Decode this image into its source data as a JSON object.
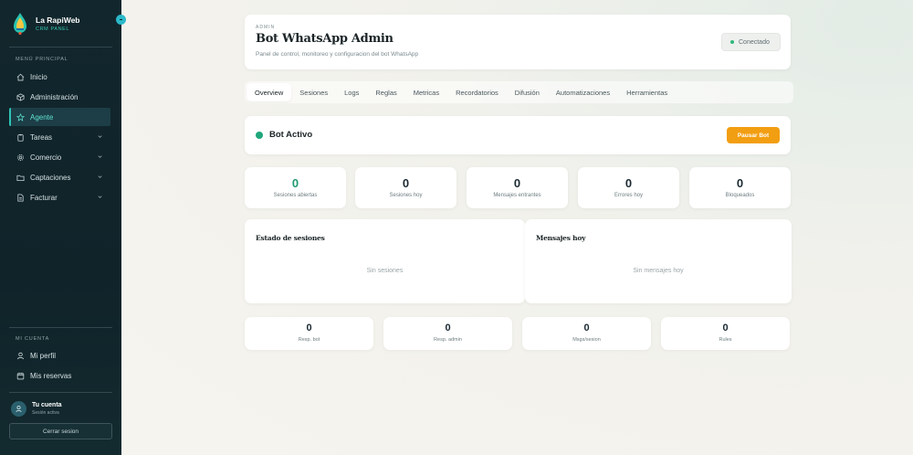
{
  "brand": {
    "title": "La RapiWeb",
    "subtitle": "CRM PANEL"
  },
  "sidebar": {
    "main_section_label": "MENÚ PRINCIPAL",
    "items": [
      {
        "label": "Inicio",
        "icon": "home-icon",
        "active": false,
        "expandable": false
      },
      {
        "label": "Administración",
        "icon": "cube-icon",
        "active": false,
        "expandable": false
      },
      {
        "label": "Agente",
        "icon": "star-icon",
        "active": true,
        "expandable": false
      },
      {
        "label": "Tareas",
        "icon": "clipboard-icon",
        "active": false,
        "expandable": true
      },
      {
        "label": "Comercio",
        "icon": "gear-icon",
        "active": false,
        "expandable": true
      },
      {
        "label": "Captaciones",
        "icon": "folder-icon",
        "active": false,
        "expandable": true
      },
      {
        "label": "Facturar",
        "icon": "document-icon",
        "active": false,
        "expandable": true
      }
    ],
    "account_section_label": "MI CUENTA",
    "account_items": [
      {
        "label": "Mi perfil",
        "icon": "user-icon"
      },
      {
        "label": "Mis reservas",
        "icon": "calendar-icon"
      }
    ],
    "user": {
      "name": "Tu cuenta",
      "status": "Sesión activa"
    },
    "logout_label": "Cerrar sesion"
  },
  "header": {
    "eyebrow": "ADMIN",
    "title": "Bot WhatsApp Admin",
    "subtitle": "Panel de control, monitoreo y configuracion del bot WhatsApp",
    "status": "Conectado"
  },
  "tabs": [
    {
      "label": "Overview",
      "active": true
    },
    {
      "label": "Sesiones",
      "active": false
    },
    {
      "label": "Logs",
      "active": false
    },
    {
      "label": "Reglas",
      "active": false
    },
    {
      "label": "Metricas",
      "active": false
    },
    {
      "label": "Recordatorios",
      "active": false
    },
    {
      "label": "Difusión",
      "active": false
    },
    {
      "label": "Automatizaciones",
      "active": false
    },
    {
      "label": "Herramientas",
      "active": false
    }
  ],
  "bot": {
    "status_label": "Bot Activo",
    "pause_label": "Pausar Bot"
  },
  "stats": [
    {
      "value": "0",
      "label": "Sesiones abiertas",
      "highlight": true
    },
    {
      "value": "0",
      "label": "Sesiones hoy",
      "highlight": false
    },
    {
      "value": "0",
      "label": "Mensajes entrantes",
      "highlight": false
    },
    {
      "value": "0",
      "label": "Errores hoy",
      "highlight": false
    },
    {
      "value": "0",
      "label": "Bloqueados",
      "highlight": false
    }
  ],
  "panels": [
    {
      "title": "Estado de sesiones",
      "empty": "Sin sesiones"
    },
    {
      "title": "Mensajes hoy",
      "empty": "Sin mensajes hoy"
    }
  ],
  "mini_stats": [
    {
      "value": "0",
      "label": "Resp. bot"
    },
    {
      "value": "0",
      "label": "Resp. admin"
    },
    {
      "value": "0",
      "label": "Msgs/sesion"
    },
    {
      "value": "0",
      "label": "Rules"
    }
  ],
  "colors": {
    "sidebar_bg": "#12272d",
    "accent": "#2ec4b6",
    "status_green": "#1fa67a",
    "pause_orange": "#f29e12"
  }
}
